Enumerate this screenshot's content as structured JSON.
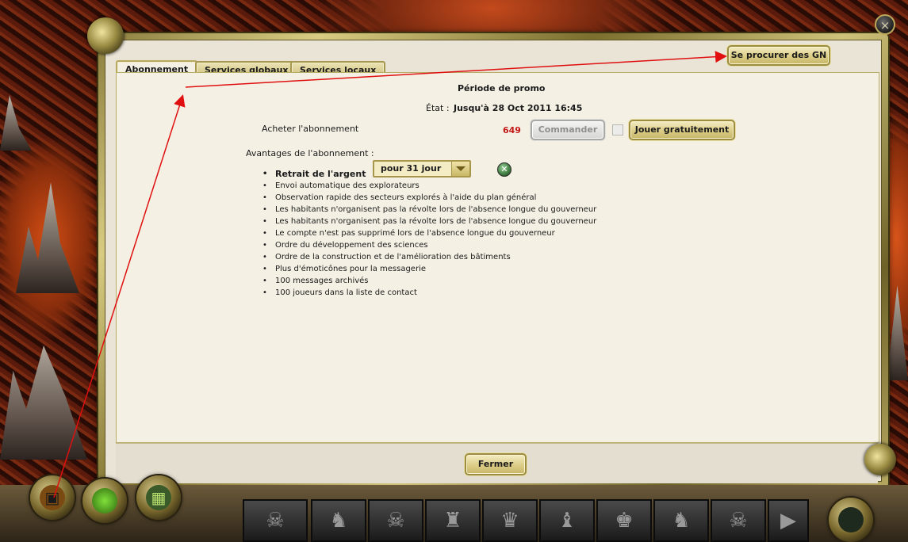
{
  "tabs": [
    {
      "label": "Abonnement",
      "active": true
    },
    {
      "label": "Services globaux",
      "active": false
    },
    {
      "label": "Services locaux",
      "active": false
    }
  ],
  "get_gn_button": "Se procurer des GN",
  "close_icon": "×",
  "promo_title": "Période de promo",
  "state": {
    "label": "État :",
    "value": "Jusqu'à 28 Oct 2011 16:45"
  },
  "buy": {
    "label": "Acheter l'abonnement",
    "selected": "pour 31 jour",
    "price": "649",
    "currency_icon": "gn-coin-icon",
    "order_button": "Commander",
    "free_button": "Jouer gratuitement"
  },
  "benefits_title": "Avantages de l'abonnement :",
  "benefits": [
    "Retrait de l'argent",
    "Envoi automatique des explorateurs",
    "Observation rapide des secteurs explorés à l'aide du plan général",
    "Les habitants n'organisent pas la révolte lors de l'absence longue du gouverneur",
    "Les habitants n'organisent pas la révolte lors de l'absence longue du gouverneur",
    "Le compte n'est pas supprimé lors de l'absence longue du gouverneur",
    "Ordre du développement des sciences",
    "Ordre de la construction et de l'amélioration des bâtiments",
    "Plus d'émoticônes pour la messagerie",
    "100 messages archivés",
    "100 joueurs dans la liste de contact"
  ],
  "close_button": "Fermer",
  "colors": {
    "price": "#c41818",
    "annotation_arrow": "#e01010",
    "gold": "#c9b866"
  }
}
